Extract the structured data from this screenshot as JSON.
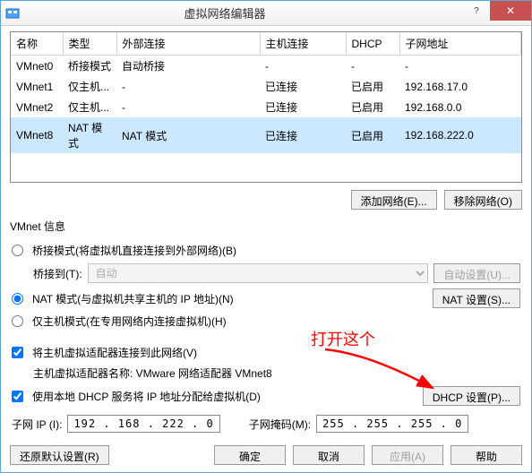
{
  "window": {
    "title": "虚拟网络编辑器",
    "close_glyph": "✕",
    "help_glyph": "?"
  },
  "table": {
    "headers": {
      "name": "名称",
      "type": "类型",
      "ext": "外部连接",
      "host": "主机连接",
      "dhcp": "DHCP",
      "subnet": "子网地址"
    },
    "rows": [
      {
        "name": "VMnet0",
        "type": "桥接模式",
        "ext": "自动桥接",
        "host": "-",
        "dhcp": "-",
        "subnet": "-",
        "selected": false
      },
      {
        "name": "VMnet1",
        "type": "仅主机...",
        "ext": "-",
        "host": "已连接",
        "dhcp": "已启用",
        "subnet": "192.168.17.0",
        "selected": false
      },
      {
        "name": "VMnet2",
        "type": "仅主机...",
        "ext": "-",
        "host": "已连接",
        "dhcp": "已启用",
        "subnet": "192.168.0.0",
        "selected": false
      },
      {
        "name": "VMnet8",
        "type": "NAT 模式",
        "ext": "NAT 模式",
        "host": "已连接",
        "dhcp": "已启用",
        "subnet": "192.168.222.0",
        "selected": true
      }
    ]
  },
  "buttons": {
    "add_net": "添加网络(E)...",
    "remove_net": "移除网络(O)"
  },
  "info_label": "VMnet 信息",
  "mode": {
    "bridged": "桥接模式(将虚拟机直接连接到外部网络)(B)",
    "bridge_to": "桥接到(T):",
    "bridge_auto_value": "自动",
    "auto_settings": "自动设置(U)...",
    "nat": "NAT 模式(与虚拟机共享主机的 IP 地址)(N)",
    "nat_settings": "NAT 设置(S)...",
    "hostonly": "仅主机模式(在专用网络内连接虚拟机)(H)"
  },
  "opts": {
    "connect_host": "将主机虚拟适配器连接到此网络(V)",
    "adapter_label": "主机虚拟适配器名称: VMware 网络适配器 VMnet8",
    "use_dhcp": "使用本地 DHCP 服务将 IP 地址分配给虚拟机(D)",
    "dhcp_settings": "DHCP 设置(P)..."
  },
  "ip": {
    "subnet_label": "子网 IP (I):",
    "subnet_value": "192 . 168 . 222 .  0",
    "mask_label": "子网掩码(M):",
    "mask_value": "255 . 255 . 255 .  0"
  },
  "footer": {
    "restore": "还原默认设置(R)",
    "ok": "确定",
    "cancel": "取消",
    "apply": "应用(A)",
    "help": "帮助"
  },
  "annotation": {
    "text": "打开这个"
  }
}
